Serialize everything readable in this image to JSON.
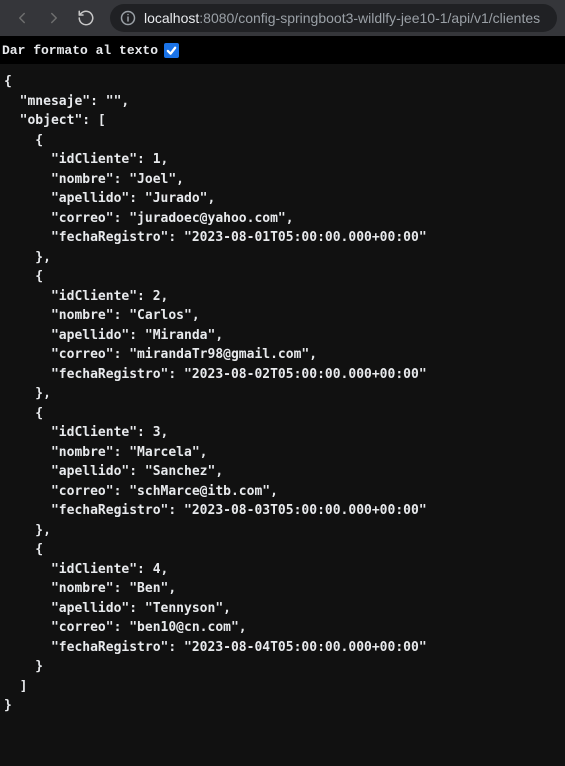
{
  "browser": {
    "url_host": "localhost",
    "url_port_path": ":8080/config-springboot3-wildlfy-jee10-1/api/v1/clientes"
  },
  "format_bar": {
    "label": "Dar formato al texto",
    "checked": true
  },
  "response": {
    "mnesaje": "",
    "object": [
      {
        "idCliente": 1,
        "nombre": "Joel",
        "apellido": "Jurado",
        "correo": "juradoec@yahoo.com",
        "fechaRegistro": "2023-08-01T05:00:00.000+00:00"
      },
      {
        "idCliente": 2,
        "nombre": "Carlos",
        "apellido": "Miranda",
        "correo": "mirandaTr98@gmail.com",
        "fechaRegistro": "2023-08-02T05:00:00.000+00:00"
      },
      {
        "idCliente": 3,
        "nombre": "Marcela",
        "apellido": "Sanchez",
        "correo": "schMarce@itb.com",
        "fechaRegistro": "2023-08-03T05:00:00.000+00:00"
      },
      {
        "idCliente": 4,
        "nombre": "Ben",
        "apellido": "Tennyson",
        "correo": "ben10@cn.com",
        "fechaRegistro": "2023-08-04T05:00:00.000+00:00"
      }
    ]
  }
}
